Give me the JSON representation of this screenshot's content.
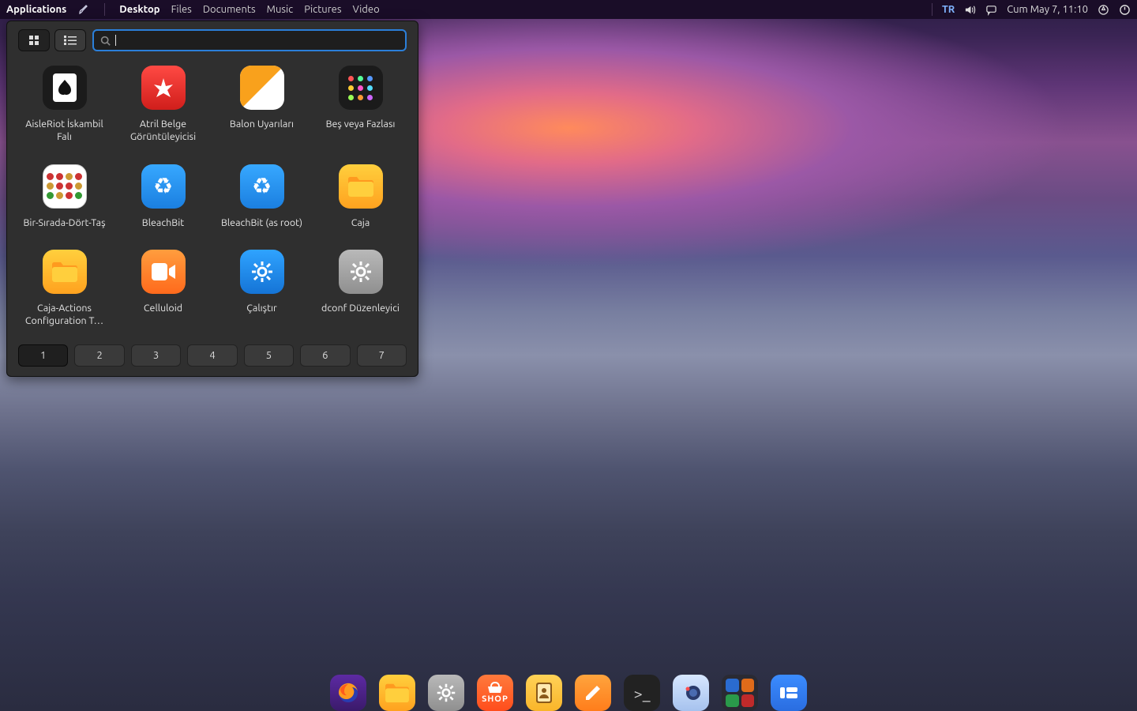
{
  "panel": {
    "applications": "Applications",
    "places": [
      "Desktop",
      "Files",
      "Documents",
      "Music",
      "Pictures",
      "Video"
    ],
    "active_place_index": 0,
    "lang": "TR",
    "datetime": "Cum May  7, 11:10"
  },
  "launcher": {
    "search_placeholder": "",
    "apps": [
      {
        "label": "AisleRiot İskambil Falı",
        "icon": "ace"
      },
      {
        "label": "Atril Belge Görüntüleyicisi",
        "icon": "pdf"
      },
      {
        "label": "Balon Uyarıları",
        "icon": "balloon"
      },
      {
        "label": "Beş veya Fazlası",
        "icon": "dots"
      },
      {
        "label": "Bir-Sırada-Dört-Taş",
        "icon": "connect"
      },
      {
        "label": "BleachBit",
        "icon": "recycle"
      },
      {
        "label": "BleachBit (as root)",
        "icon": "recycle"
      },
      {
        "label": "Caja",
        "icon": "folder"
      },
      {
        "label": "Caja-Actions Configuration T…",
        "icon": "folder"
      },
      {
        "label": "Celluloid",
        "icon": "video"
      },
      {
        "label": "Çalıştır",
        "icon": "gear-blue"
      },
      {
        "label": "dconf Düzenleyici",
        "icon": "gear-grey"
      }
    ],
    "pages": [
      "1",
      "2",
      "3",
      "4",
      "5",
      "6",
      "7"
    ],
    "active_page": 0
  },
  "dock": {
    "items": [
      {
        "name": "firefox",
        "icon": "firefox"
      },
      {
        "name": "files",
        "icon": "folder"
      },
      {
        "name": "settings",
        "icon": "gear-grey"
      },
      {
        "name": "software-shop",
        "icon": "shop",
        "label": "SHOP"
      },
      {
        "name": "contacts",
        "icon": "contacts"
      },
      {
        "name": "notes",
        "icon": "note"
      },
      {
        "name": "terminal",
        "icon": "term"
      },
      {
        "name": "camera",
        "icon": "camera"
      },
      {
        "name": "office-group",
        "icon": "group"
      },
      {
        "name": "dashboard",
        "icon": "dash"
      }
    ]
  }
}
